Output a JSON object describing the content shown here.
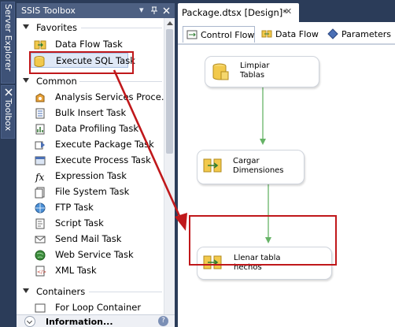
{
  "side_tabs": [
    {
      "label": "Server Explorer"
    },
    {
      "label": "Toolbox"
    }
  ],
  "toolbox": {
    "title": "SSIS Toolbox",
    "pin_glyph": "▾ ⊥ ✕",
    "groups": {
      "favorites": "Favorites",
      "common": "Common",
      "containers": "Containers"
    },
    "favorites": [
      {
        "label": "Data Flow Task",
        "icon": "data-flow-task-icon"
      },
      {
        "label": "Execute SQL Task",
        "icon": "execute-sql-task-icon"
      }
    ],
    "common": [
      {
        "label": "Analysis Services Proce...",
        "icon": "analysis-services-icon"
      },
      {
        "label": "Bulk Insert Task",
        "icon": "bulk-insert-icon"
      },
      {
        "label": "Data Profiling Task",
        "icon": "data-profiling-icon"
      },
      {
        "label": "Execute Package Task",
        "icon": "execute-package-icon"
      },
      {
        "label": "Execute Process Task",
        "icon": "execute-process-icon"
      },
      {
        "label": "Expression Task",
        "icon": "expression-icon"
      },
      {
        "label": "File System Task",
        "icon": "file-system-icon"
      },
      {
        "label": "FTP Task",
        "icon": "ftp-icon"
      },
      {
        "label": "Script Task",
        "icon": "script-icon"
      },
      {
        "label": "Send Mail Task",
        "icon": "send-mail-icon"
      },
      {
        "label": "Web Service Task",
        "icon": "web-service-icon"
      },
      {
        "label": "XML Task",
        "icon": "xml-icon"
      }
    ],
    "containers": [
      {
        "label": "For Loop Container"
      }
    ],
    "info_label": "Information...",
    "info_help": "?"
  },
  "document": {
    "tab_title": "Package.dtsx [Design]*",
    "tab_close": "✕",
    "designer_tabs": [
      {
        "label": "Control Flow",
        "active": true
      },
      {
        "label": "Data Flow",
        "active": false
      },
      {
        "label": "Parameters",
        "active": false
      }
    ]
  },
  "canvas": {
    "tasks": [
      {
        "label": "Limpiar\nTablas",
        "icon": "execute-sql-task-icon"
      },
      {
        "label": "Cargar\nDimensiones",
        "icon": "data-flow-task-icon"
      },
      {
        "label": "Llenar tabla\nhechos",
        "icon": "data-flow-task-icon"
      }
    ]
  },
  "colors": {
    "highlight": "#c0181b",
    "connector": "#66b366",
    "chrome": "#2b3c59"
  }
}
